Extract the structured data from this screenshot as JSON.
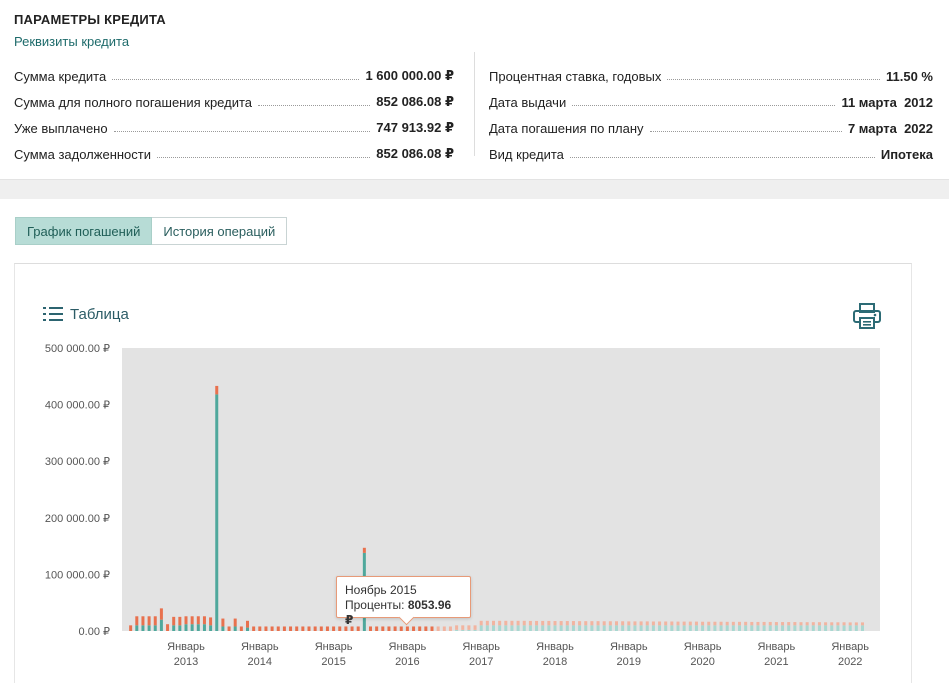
{
  "header": {
    "title": "ПАРАМЕТРЫ КРЕДИТА",
    "link": "Реквизиты кредита"
  },
  "params_left": [
    {
      "label": "Сумма кредита",
      "value": "1 600 000.00 ₽"
    },
    {
      "label": "Сумма для полного погашения кредита",
      "value": "852 086.08 ₽"
    },
    {
      "label": "Уже выплачено",
      "value": "747 913.92 ₽"
    },
    {
      "label": "Сумма задолженности",
      "value": "852 086.08 ₽"
    }
  ],
  "params_right": [
    {
      "label": "Процентная ставка, годовых",
      "value": "11.50 %"
    },
    {
      "label": "Дата выдачи",
      "value": "11 марта  2012"
    },
    {
      "label": "Дата погашения по плану",
      "value": "7 марта  2022"
    },
    {
      "label": "Вид кредита",
      "value": "Ипотека"
    }
  ],
  "tabs": [
    {
      "label": "График погашений",
      "active": true
    },
    {
      "label": "История операций",
      "active": false
    }
  ],
  "panel": {
    "table_link": "Таблица",
    "icons": {
      "table": "list-icon",
      "print": "printer-icon"
    }
  },
  "tooltip": {
    "title": "Ноябрь 2015",
    "label": "Проценты:",
    "value": "8053.96 ₽"
  },
  "chart_data": {
    "type": "bar",
    "stacked": true,
    "ylim": [
      0,
      500000
    ],
    "yticks": [
      "0.00 ₽",
      "100 000.00 ₽",
      "200 000.00 ₽",
      "300 000.00 ₽",
      "400 000.00 ₽",
      "500 000.00 ₽"
    ],
    "xticks": [
      {
        "month": "Январь",
        "year": "2013"
      },
      {
        "month": "Январь",
        "year": "2014"
      },
      {
        "month": "Январь",
        "year": "2015"
      },
      {
        "month": "Январь",
        "year": "2016"
      },
      {
        "month": "Январь",
        "year": "2017"
      },
      {
        "month": "Январь",
        "year": "2018"
      },
      {
        "month": "Январь",
        "year": "2019"
      },
      {
        "month": "Январь",
        "year": "2020"
      },
      {
        "month": "Январь",
        "year": "2021"
      },
      {
        "month": "Январь",
        "year": "2022"
      }
    ],
    "series_colors": {
      "principal": "#4fa89c",
      "interest": "#e8714e",
      "planned_principal": "#a9d8d1",
      "planned_interest": "#f2b4a0"
    },
    "bars": [
      {
        "x": "2012-04",
        "principal": 0,
        "interest": 10000,
        "planned": false
      },
      {
        "x": "2012-05",
        "principal": 10000,
        "interest": 16000,
        "planned": false
      },
      {
        "x": "2012-06",
        "principal": 10000,
        "interest": 16000,
        "planned": false
      },
      {
        "x": "2012-07",
        "principal": 10000,
        "interest": 16000,
        "planned": false
      },
      {
        "x": "2012-08",
        "principal": 10000,
        "interest": 16000,
        "planned": false
      },
      {
        "x": "2012-09",
        "principal": 20000,
        "interest": 20000,
        "planned": false
      },
      {
        "x": "2012-10",
        "principal": 0,
        "interest": 12000,
        "planned": false
      },
      {
        "x": "2012-11",
        "principal": 10000,
        "interest": 15000,
        "planned": false
      },
      {
        "x": "2012-12",
        "principal": 10000,
        "interest": 15000,
        "planned": false
      },
      {
        "x": "2013-01",
        "principal": 12000,
        "interest": 14000,
        "planned": false
      },
      {
        "x": "2013-02",
        "principal": 12000,
        "interest": 14000,
        "planned": false
      },
      {
        "x": "2013-03",
        "principal": 12000,
        "interest": 14000,
        "planned": false
      },
      {
        "x": "2013-04",
        "principal": 12000,
        "interest": 14000,
        "planned": false
      },
      {
        "x": "2013-05",
        "principal": 10000,
        "interest": 14000,
        "planned": false
      },
      {
        "x": "2013-06",
        "principal": 418000,
        "interest": 15000,
        "planned": false
      },
      {
        "x": "2013-07",
        "principal": 8000,
        "interest": 14000,
        "planned": false
      },
      {
        "x": "2013-08",
        "principal": 0,
        "interest": 8000,
        "planned": false
      },
      {
        "x": "2013-09",
        "principal": 8000,
        "interest": 14000,
        "planned": false
      },
      {
        "x": "2013-10",
        "principal": 0,
        "interest": 8000,
        "planned": false
      },
      {
        "x": "2013-11",
        "principal": 6000,
        "interest": 12000,
        "planned": false
      },
      {
        "x": "2013-12",
        "principal": 0,
        "interest": 8000,
        "planned": false
      },
      {
        "x": "2014-01",
        "principal": 0,
        "interest": 8000,
        "planned": false
      },
      {
        "x": "2014-02",
        "principal": 0,
        "interest": 8000,
        "planned": false
      },
      {
        "x": "2014-03",
        "principal": 0,
        "interest": 8000,
        "planned": false
      },
      {
        "x": "2014-04",
        "principal": 0,
        "interest": 8000,
        "planned": false
      },
      {
        "x": "2014-05",
        "principal": 0,
        "interest": 8000,
        "planned": false
      },
      {
        "x": "2014-06",
        "principal": 0,
        "interest": 8000,
        "planned": false
      },
      {
        "x": "2014-07",
        "principal": 0,
        "interest": 8000,
        "planned": false
      },
      {
        "x": "2014-08",
        "principal": 0,
        "interest": 8000,
        "planned": false
      },
      {
        "x": "2014-09",
        "principal": 0,
        "interest": 8000,
        "planned": false
      },
      {
        "x": "2014-10",
        "principal": 0,
        "interest": 8000,
        "planned": false
      },
      {
        "x": "2014-11",
        "principal": 0,
        "interest": 8000,
        "planned": false
      },
      {
        "x": "2014-12",
        "principal": 0,
        "interest": 8000,
        "planned": false
      },
      {
        "x": "2015-01",
        "principal": 0,
        "interest": 8000,
        "planned": false
      },
      {
        "x": "2015-02",
        "principal": 0,
        "interest": 8000,
        "planned": false
      },
      {
        "x": "2015-03",
        "principal": 0,
        "interest": 8000,
        "planned": false
      },
      {
        "x": "2015-04",
        "principal": 0,
        "interest": 8000,
        "planned": false
      },
      {
        "x": "2015-05",
        "principal": 0,
        "interest": 8000,
        "planned": false
      },
      {
        "x": "2015-06",
        "principal": 138000,
        "interest": 9000,
        "planned": false
      },
      {
        "x": "2015-07",
        "principal": 0,
        "interest": 8000,
        "planned": false
      },
      {
        "x": "2015-08",
        "principal": 0,
        "interest": 8000,
        "planned": false
      },
      {
        "x": "2015-09",
        "principal": 0,
        "interest": 8000,
        "planned": false
      },
      {
        "x": "2015-10",
        "principal": 0,
        "interest": 8000,
        "planned": false
      },
      {
        "x": "2015-11",
        "principal": 0,
        "interest": 8053.96,
        "planned": false
      },
      {
        "x": "2015-12",
        "principal": 0,
        "interest": 8000,
        "planned": false
      },
      {
        "x": "2016-01",
        "principal": 0,
        "interest": 8000,
        "planned": false
      },
      {
        "x": "2016-02",
        "principal": 0,
        "interest": 8000,
        "planned": false
      },
      {
        "x": "2016-03",
        "principal": 0,
        "interest": 8000,
        "planned": false
      },
      {
        "x": "2016-04",
        "principal": 0,
        "interest": 8000,
        "planned": false
      },
      {
        "x": "2016-05",
        "principal": 0,
        "interest": 8000,
        "planned": false
      },
      {
        "x": "2016-06",
        "principal": 0,
        "interest": 8000,
        "planned": true
      },
      {
        "x": "2016-07",
        "principal": 0,
        "interest": 8000,
        "planned": true
      },
      {
        "x": "2016-08",
        "principal": 0,
        "interest": 8000,
        "planned": true
      },
      {
        "x": "2016-09",
        "principal": 2000,
        "interest": 8000,
        "planned": true
      },
      {
        "x": "2016-10",
        "principal": 2000,
        "interest": 8000,
        "planned": true
      },
      {
        "x": "2016-11",
        "principal": 2000,
        "interest": 8000,
        "planned": true
      },
      {
        "x": "2016-12",
        "principal": 2000,
        "interest": 8000,
        "planned": true
      },
      {
        "x": "2017-01",
        "principal": 10000,
        "interest": 8000,
        "planned": true
      },
      {
        "x": "2017-02",
        "principal": 10000,
        "interest": 8000,
        "planned": true
      },
      {
        "x": "2017-03",
        "principal": 10000,
        "interest": 8000,
        "planned": true
      },
      {
        "x": "2017-04",
        "principal": 10000,
        "interest": 8000,
        "planned": true
      },
      {
        "x": "2017-05",
        "principal": 10000,
        "interest": 8000,
        "planned": true
      },
      {
        "x": "2017-06",
        "principal": 10000,
        "interest": 8000,
        "planned": true
      },
      {
        "x": "2017-07",
        "principal": 10000,
        "interest": 8000,
        "planned": true
      },
      {
        "x": "2017-08",
        "principal": 10000,
        "interest": 8000,
        "planned": true
      },
      {
        "x": "2017-09",
        "principal": 10000,
        "interest": 7800,
        "planned": true
      },
      {
        "x": "2017-10",
        "principal": 10000,
        "interest": 7800,
        "planned": true
      },
      {
        "x": "2017-11",
        "principal": 10000,
        "interest": 7800,
        "planned": true
      },
      {
        "x": "2017-12",
        "principal": 10000,
        "interest": 7800,
        "planned": true
      },
      {
        "x": "2018-01",
        "principal": 10000,
        "interest": 7600,
        "planned": true
      },
      {
        "x": "2018-02",
        "principal": 10000,
        "interest": 7600,
        "planned": true
      },
      {
        "x": "2018-03",
        "principal": 10000,
        "interest": 7600,
        "planned": true
      },
      {
        "x": "2018-04",
        "principal": 10000,
        "interest": 7600,
        "planned": true
      },
      {
        "x": "2018-05",
        "principal": 10000,
        "interest": 7400,
        "planned": true
      },
      {
        "x": "2018-06",
        "principal": 10000,
        "interest": 7400,
        "planned": true
      },
      {
        "x": "2018-07",
        "principal": 10000,
        "interest": 7400,
        "planned": true
      },
      {
        "x": "2018-08",
        "principal": 10000,
        "interest": 7400,
        "planned": true
      },
      {
        "x": "2018-09",
        "principal": 10000,
        "interest": 7200,
        "planned": true
      },
      {
        "x": "2018-10",
        "principal": 10000,
        "interest": 7200,
        "planned": true
      },
      {
        "x": "2018-11",
        "principal": 10000,
        "interest": 7200,
        "planned": true
      },
      {
        "x": "2018-12",
        "principal": 10000,
        "interest": 7200,
        "planned": true
      },
      {
        "x": "2019-01",
        "principal": 10000,
        "interest": 7000,
        "planned": true
      },
      {
        "x": "2019-02",
        "principal": 10000,
        "interest": 7000,
        "planned": true
      },
      {
        "x": "2019-03",
        "principal": 10000,
        "interest": 7000,
        "planned": true
      },
      {
        "x": "2019-04",
        "principal": 10000,
        "interest": 7000,
        "planned": true
      },
      {
        "x": "2019-05",
        "principal": 10000,
        "interest": 6800,
        "planned": true
      },
      {
        "x": "2019-06",
        "principal": 10000,
        "interest": 6800,
        "planned": true
      },
      {
        "x": "2019-07",
        "principal": 10000,
        "interest": 6800,
        "planned": true
      },
      {
        "x": "2019-08",
        "principal": 10000,
        "interest": 6800,
        "planned": true
      },
      {
        "x": "2019-09",
        "principal": 10000,
        "interest": 6600,
        "planned": true
      },
      {
        "x": "2019-10",
        "principal": 10000,
        "interest": 6600,
        "planned": true
      },
      {
        "x": "2019-11",
        "principal": 10000,
        "interest": 6600,
        "planned": true
      },
      {
        "x": "2019-12",
        "principal": 10000,
        "interest": 6600,
        "planned": true
      },
      {
        "x": "2020-01",
        "principal": 10000,
        "interest": 6400,
        "planned": true
      },
      {
        "x": "2020-02",
        "principal": 10000,
        "interest": 6400,
        "planned": true
      },
      {
        "x": "2020-03",
        "principal": 10000,
        "interest": 6400,
        "planned": true
      },
      {
        "x": "2020-04",
        "principal": 10000,
        "interest": 6400,
        "planned": true
      },
      {
        "x": "2020-05",
        "principal": 10000,
        "interest": 6200,
        "planned": true
      },
      {
        "x": "2020-06",
        "principal": 10000,
        "interest": 6200,
        "planned": true
      },
      {
        "x": "2020-07",
        "principal": 10000,
        "interest": 6200,
        "planned": true
      },
      {
        "x": "2020-08",
        "principal": 10000,
        "interest": 6200,
        "planned": true
      },
      {
        "x": "2020-09",
        "principal": 10000,
        "interest": 6000,
        "planned": true
      },
      {
        "x": "2020-10",
        "principal": 10000,
        "interest": 6000,
        "planned": true
      },
      {
        "x": "2020-11",
        "principal": 10000,
        "interest": 6000,
        "planned": true
      },
      {
        "x": "2020-12",
        "principal": 10000,
        "interest": 6000,
        "planned": true
      },
      {
        "x": "2021-01",
        "principal": 10000,
        "interest": 5800,
        "planned": true
      },
      {
        "x": "2021-02",
        "principal": 10000,
        "interest": 5800,
        "planned": true
      },
      {
        "x": "2021-03",
        "principal": 10000,
        "interest": 5800,
        "planned": true
      },
      {
        "x": "2021-04",
        "principal": 10000,
        "interest": 5800,
        "planned": true
      },
      {
        "x": "2021-05",
        "principal": 10000,
        "interest": 5600,
        "planned": true
      },
      {
        "x": "2021-06",
        "principal": 10000,
        "interest": 5600,
        "planned": true
      },
      {
        "x": "2021-07",
        "principal": 10000,
        "interest": 5600,
        "planned": true
      },
      {
        "x": "2021-08",
        "principal": 10000,
        "interest": 5600,
        "planned": true
      },
      {
        "x": "2021-09",
        "principal": 10000,
        "interest": 5400,
        "planned": true
      },
      {
        "x": "2021-10",
        "principal": 10000,
        "interest": 5400,
        "planned": true
      },
      {
        "x": "2021-11",
        "principal": 10000,
        "interest": 5400,
        "planned": true
      },
      {
        "x": "2021-12",
        "principal": 10000,
        "interest": 5400,
        "planned": true
      },
      {
        "x": "2022-01",
        "principal": 10000,
        "interest": 5200,
        "planned": true
      },
      {
        "x": "2022-02",
        "principal": 10000,
        "interest": 5200,
        "planned": true
      },
      {
        "x": "2022-03",
        "principal": 10000,
        "interest": 5200,
        "planned": true
      }
    ]
  }
}
